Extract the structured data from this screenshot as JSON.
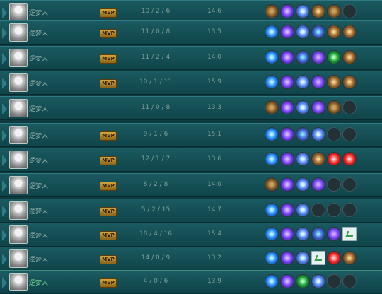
{
  "rows": [
    {
      "name": "逻梦人",
      "badge": "MVP",
      "kda": "10 / 2 / 6",
      "score": "14.6",
      "items": [
        "boots",
        "arcane",
        "blade",
        "book",
        "boots",
        "empty"
      ]
    },
    {
      "name": "逻梦人",
      "badge": "MVP",
      "kda": "11 / 0 / 8",
      "score": "13.5",
      "items": [
        "spell",
        "arcane",
        "blade",
        "orb",
        "book",
        "book"
      ]
    },
    {
      "name": "逻梦人",
      "badge": "MVP",
      "kda": "11 / 2 / 4",
      "score": "14.0",
      "items": [
        "spell",
        "arcane",
        "orb",
        "hand",
        "green",
        "book"
      ]
    },
    {
      "name": "逻梦人",
      "badge": "MVP",
      "kda": "10 / 1 / 11",
      "score": "15.9",
      "items": [
        "spell",
        "arcane",
        "blade",
        "hand",
        "book",
        "book"
      ]
    },
    {
      "name": "逻梦人",
      "badge": "",
      "kda": "11 / 0 / 8",
      "score": "13.3",
      "items": [
        "boots",
        "arcane",
        "blade",
        "hand",
        "boots",
        "empty"
      ]
    },
    {
      "name": "逻梦人",
      "badge": "MVP",
      "kda": "9 / 1 / 6",
      "score": "15.1",
      "items": [
        "spell",
        "arcane",
        "orb",
        "blade",
        "empty",
        "empty"
      ]
    },
    {
      "name": "逻梦人",
      "badge": "MVP",
      "kda": "12 / 1 / 7",
      "score": "13.6",
      "items": [
        "spell",
        "arcane",
        "blade",
        "book",
        "red",
        "red"
      ]
    },
    {
      "name": "逻梦人",
      "badge": "MVP",
      "kda": "8 / 2 / 8",
      "score": "14.0",
      "items": [
        "boots",
        "arcane",
        "blade",
        "hand",
        "empty",
        "empty"
      ]
    },
    {
      "name": "逻梦人",
      "badge": "MVP",
      "kda": "5 / 2 / 15",
      "score": "14.7",
      "items": [
        "spell",
        "arcane",
        "blade",
        "empty",
        "empty",
        "empty"
      ]
    },
    {
      "name": "逻梦人",
      "badge": "MVP",
      "kda": "18 / 4 / 16",
      "score": "15.4",
      "items": [
        "spell",
        "arcane",
        "blade",
        "orb",
        "hand",
        "broken"
      ]
    },
    {
      "name": "逻梦人",
      "badge": "MVP",
      "kda": "14 / 0 / 9",
      "score": "13.2",
      "items": [
        "spell",
        "arcane",
        "blade",
        "broken",
        "red",
        "book"
      ]
    },
    {
      "name": "逻梦人",
      "badge": "MVP",
      "kda": "4 / 0 / 6",
      "score": "13.9",
      "items": [
        "spell",
        "arcane",
        "green",
        "blade",
        "empty",
        "empty"
      ]
    }
  ]
}
